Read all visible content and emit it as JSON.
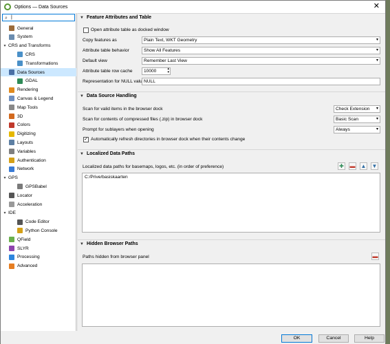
{
  "window": {
    "title": "Options — Data Sources",
    "close_glyph": "✕"
  },
  "search": {
    "value": "|"
  },
  "sidebar": {
    "items": [
      {
        "label": "General",
        "icon": "wrench-icon",
        "color": "#9b6b3a",
        "level": 1
      },
      {
        "label": "System",
        "icon": "system-icon",
        "color": "#6a8caf",
        "level": 1
      },
      {
        "label": "CRS and Transforms",
        "icon": "caret-down",
        "color": "",
        "level": 0
      },
      {
        "label": "CRS",
        "icon": "globe-icon",
        "color": "#4a90c8",
        "level": 2
      },
      {
        "label": "Transformations",
        "icon": "globe-icon",
        "color": "#4a90c8",
        "level": 2
      },
      {
        "label": "Data Sources",
        "icon": "table-icon",
        "color": "#4a6fa5",
        "level": 1,
        "selected": true
      },
      {
        "label": "GDAL",
        "icon": "gdal-icon",
        "color": "#2e8b57",
        "level": 2
      },
      {
        "label": "Rendering",
        "icon": "rendering-icon",
        "color": "#e08a1e",
        "level": 1
      },
      {
        "label": "Canvas & Legend",
        "icon": "canvas-icon",
        "color": "#6f8fbf",
        "level": 1
      },
      {
        "label": "Map Tools",
        "icon": "maptools-icon",
        "color": "#888888",
        "level": 1
      },
      {
        "label": "3D",
        "icon": "3d-icon",
        "color": "#d2691e",
        "level": 1
      },
      {
        "label": "Colors",
        "icon": "colors-icon",
        "color": "#c0392b",
        "level": 1
      },
      {
        "label": "Digitizing",
        "icon": "digitizing-icon",
        "color": "#e6b800",
        "level": 1
      },
      {
        "label": "Layouts",
        "icon": "layouts-icon",
        "color": "#5d7fa3",
        "level": 1
      },
      {
        "label": "Variables",
        "icon": "variables-icon",
        "color": "#7f7f7f",
        "level": 1
      },
      {
        "label": "Authentication",
        "icon": "lock-icon",
        "color": "#d4a017",
        "level": 1
      },
      {
        "label": "Network",
        "icon": "network-icon",
        "color": "#3a7bd5",
        "level": 1
      },
      {
        "label": "GPS",
        "icon": "caret-down",
        "color": "",
        "level": 0
      },
      {
        "label": "GPSBabel",
        "icon": "gps-icon",
        "color": "#7a7a7a",
        "level": 2
      },
      {
        "label": "Locator",
        "icon": "locator-icon",
        "color": "#555555",
        "level": 1
      },
      {
        "label": "Acceleration",
        "icon": "acceleration-icon",
        "color": "#999999",
        "level": 1
      },
      {
        "label": "IDE",
        "icon": "caret-down",
        "color": "",
        "level": 0
      },
      {
        "label": "Code Editor",
        "icon": "code-icon",
        "color": "#555555",
        "level": 2
      },
      {
        "label": "Python Console",
        "icon": "python-icon",
        "color": "#d4a017",
        "level": 2
      },
      {
        "label": "QField",
        "icon": "qfield-icon",
        "color": "#6ab04c",
        "level": 1
      },
      {
        "label": "SLYR",
        "icon": "slyr-icon",
        "color": "#8e44ad",
        "level": 1
      },
      {
        "label": "Processing",
        "icon": "processing-icon",
        "color": "#2e86de",
        "level": 1
      },
      {
        "label": "Advanced",
        "icon": "warning-icon",
        "color": "#e67e22",
        "level": 1
      }
    ]
  },
  "feature_section": {
    "title": "Feature Attributes and Table",
    "dock_label": "Open attribute table as docked window",
    "copy_label": "Copy features as",
    "copy_value": "Plain Text, WKT Geometry",
    "behavior_label": "Attribute table behavior",
    "behavior_value": "Show All Features",
    "view_label": "Default view",
    "view_value": "Remember Last View",
    "cache_label": "Attribute table row cache",
    "cache_value": "10000",
    "null_label": "Representation for NULL values",
    "null_value": "NULL"
  },
  "handling_section": {
    "title": "Data Source Handling",
    "scan_label": "Scan for valid items in the browser dock",
    "scan_value": "Check Extension",
    "zip_label": "Scan for contents of compressed files (.zip) in browser dock",
    "zip_value": "Basic Scan",
    "prompt_label": "Prompt for sublayers when opening",
    "prompt_value": "Always",
    "refresh_label": "Automatically refresh directories in browser dock when their contents change"
  },
  "localized_section": {
    "title": "Localized Data Paths",
    "desc": "Localized data paths for basemaps, logos, etc. (in order of preference)",
    "paths": [
      "C:/Prive/basiskaarten"
    ]
  },
  "hidden_section": {
    "title": "Hidden Browser Paths",
    "desc": "Paths hidden from browser panel"
  },
  "footer": {
    "ok": "OK",
    "cancel": "Cancel",
    "help": "Help"
  }
}
